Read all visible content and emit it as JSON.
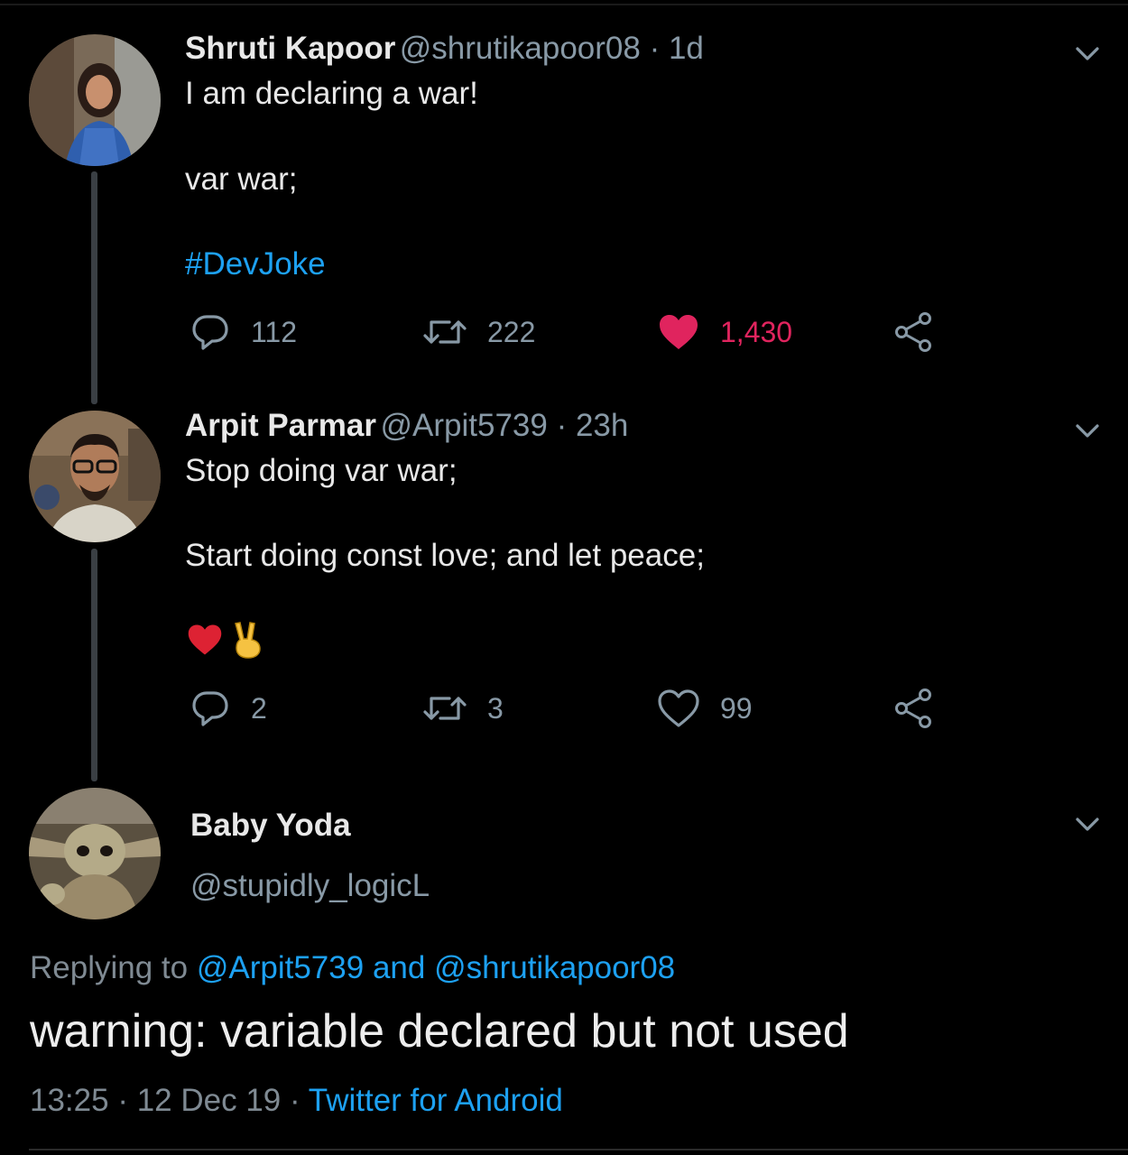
{
  "tweets": [
    {
      "name": "Shruti Kapoor",
      "meta": "@shrutikapoor08 · 1d",
      "line1": "I am declaring a war!",
      "line2": "var war;",
      "hashtag": "#DevJoke",
      "replies": "112",
      "retweets": "222",
      "likes": "1,430",
      "liked": true
    },
    {
      "name": "Arpit Parmar",
      "meta": "@Arpit5739 · 23h",
      "line1": "Stop doing var war;",
      "line2": "Start doing const love; and let peace;",
      "emoji": "❤️✌️",
      "replies": "2",
      "retweets": "3",
      "likes": "99",
      "liked": false
    }
  ],
  "main_tweet": {
    "name": "Baby Yoda",
    "handle": "@stupidly_logicL",
    "replying_prefix": "Replying to",
    "replying_user1": "@Arpit5739",
    "replying_and": "and",
    "replying_user2": "@shrutikapoor08",
    "text": "warning: variable declared but not used",
    "time": "13:25",
    "date": "12 Dec 19",
    "separator": "·",
    "source": "Twitter for Android"
  },
  "icons": {
    "reply": "reply-icon",
    "retweet": "retweet-icon",
    "like": "heart-icon",
    "share": "share-icon",
    "menu": "chevron-down-icon"
  },
  "colors": {
    "background": "#000000",
    "text": "#e8e8e8",
    "muted": "#8899a6",
    "link": "#1da1f2",
    "like": "#e0245e"
  }
}
